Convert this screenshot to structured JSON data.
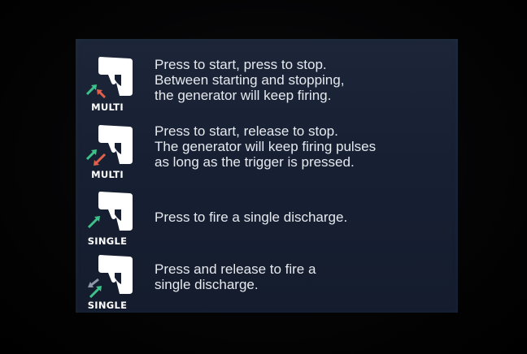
{
  "modes": [
    {
      "label": "MULTI",
      "icon": "trigger-press-press-icon",
      "lines": [
        "Press to start, press to stop.",
        "Between starting and stopping,",
        "the generator will keep firing."
      ]
    },
    {
      "label": "MULTI",
      "icon": "trigger-press-release-icon",
      "lines": [
        "Press to start, release to stop.",
        "The generator will keep firing pulses",
        "as long as the trigger is pressed."
      ]
    },
    {
      "label": "SINGLE",
      "icon": "trigger-single-press-icon",
      "lines": [
        "Press to fire a single discharge."
      ]
    },
    {
      "label": "SINGLE",
      "icon": "trigger-press-release-single-icon",
      "lines": [
        "Press and release to fire a",
        "single discharge."
      ]
    }
  ],
  "colors": {
    "screen_bg": "#172033",
    "text": "#e6e9ee",
    "arrow_green": "#3cc28a",
    "arrow_red": "#e0604c",
    "arrow_gray": "#8d97a6"
  }
}
